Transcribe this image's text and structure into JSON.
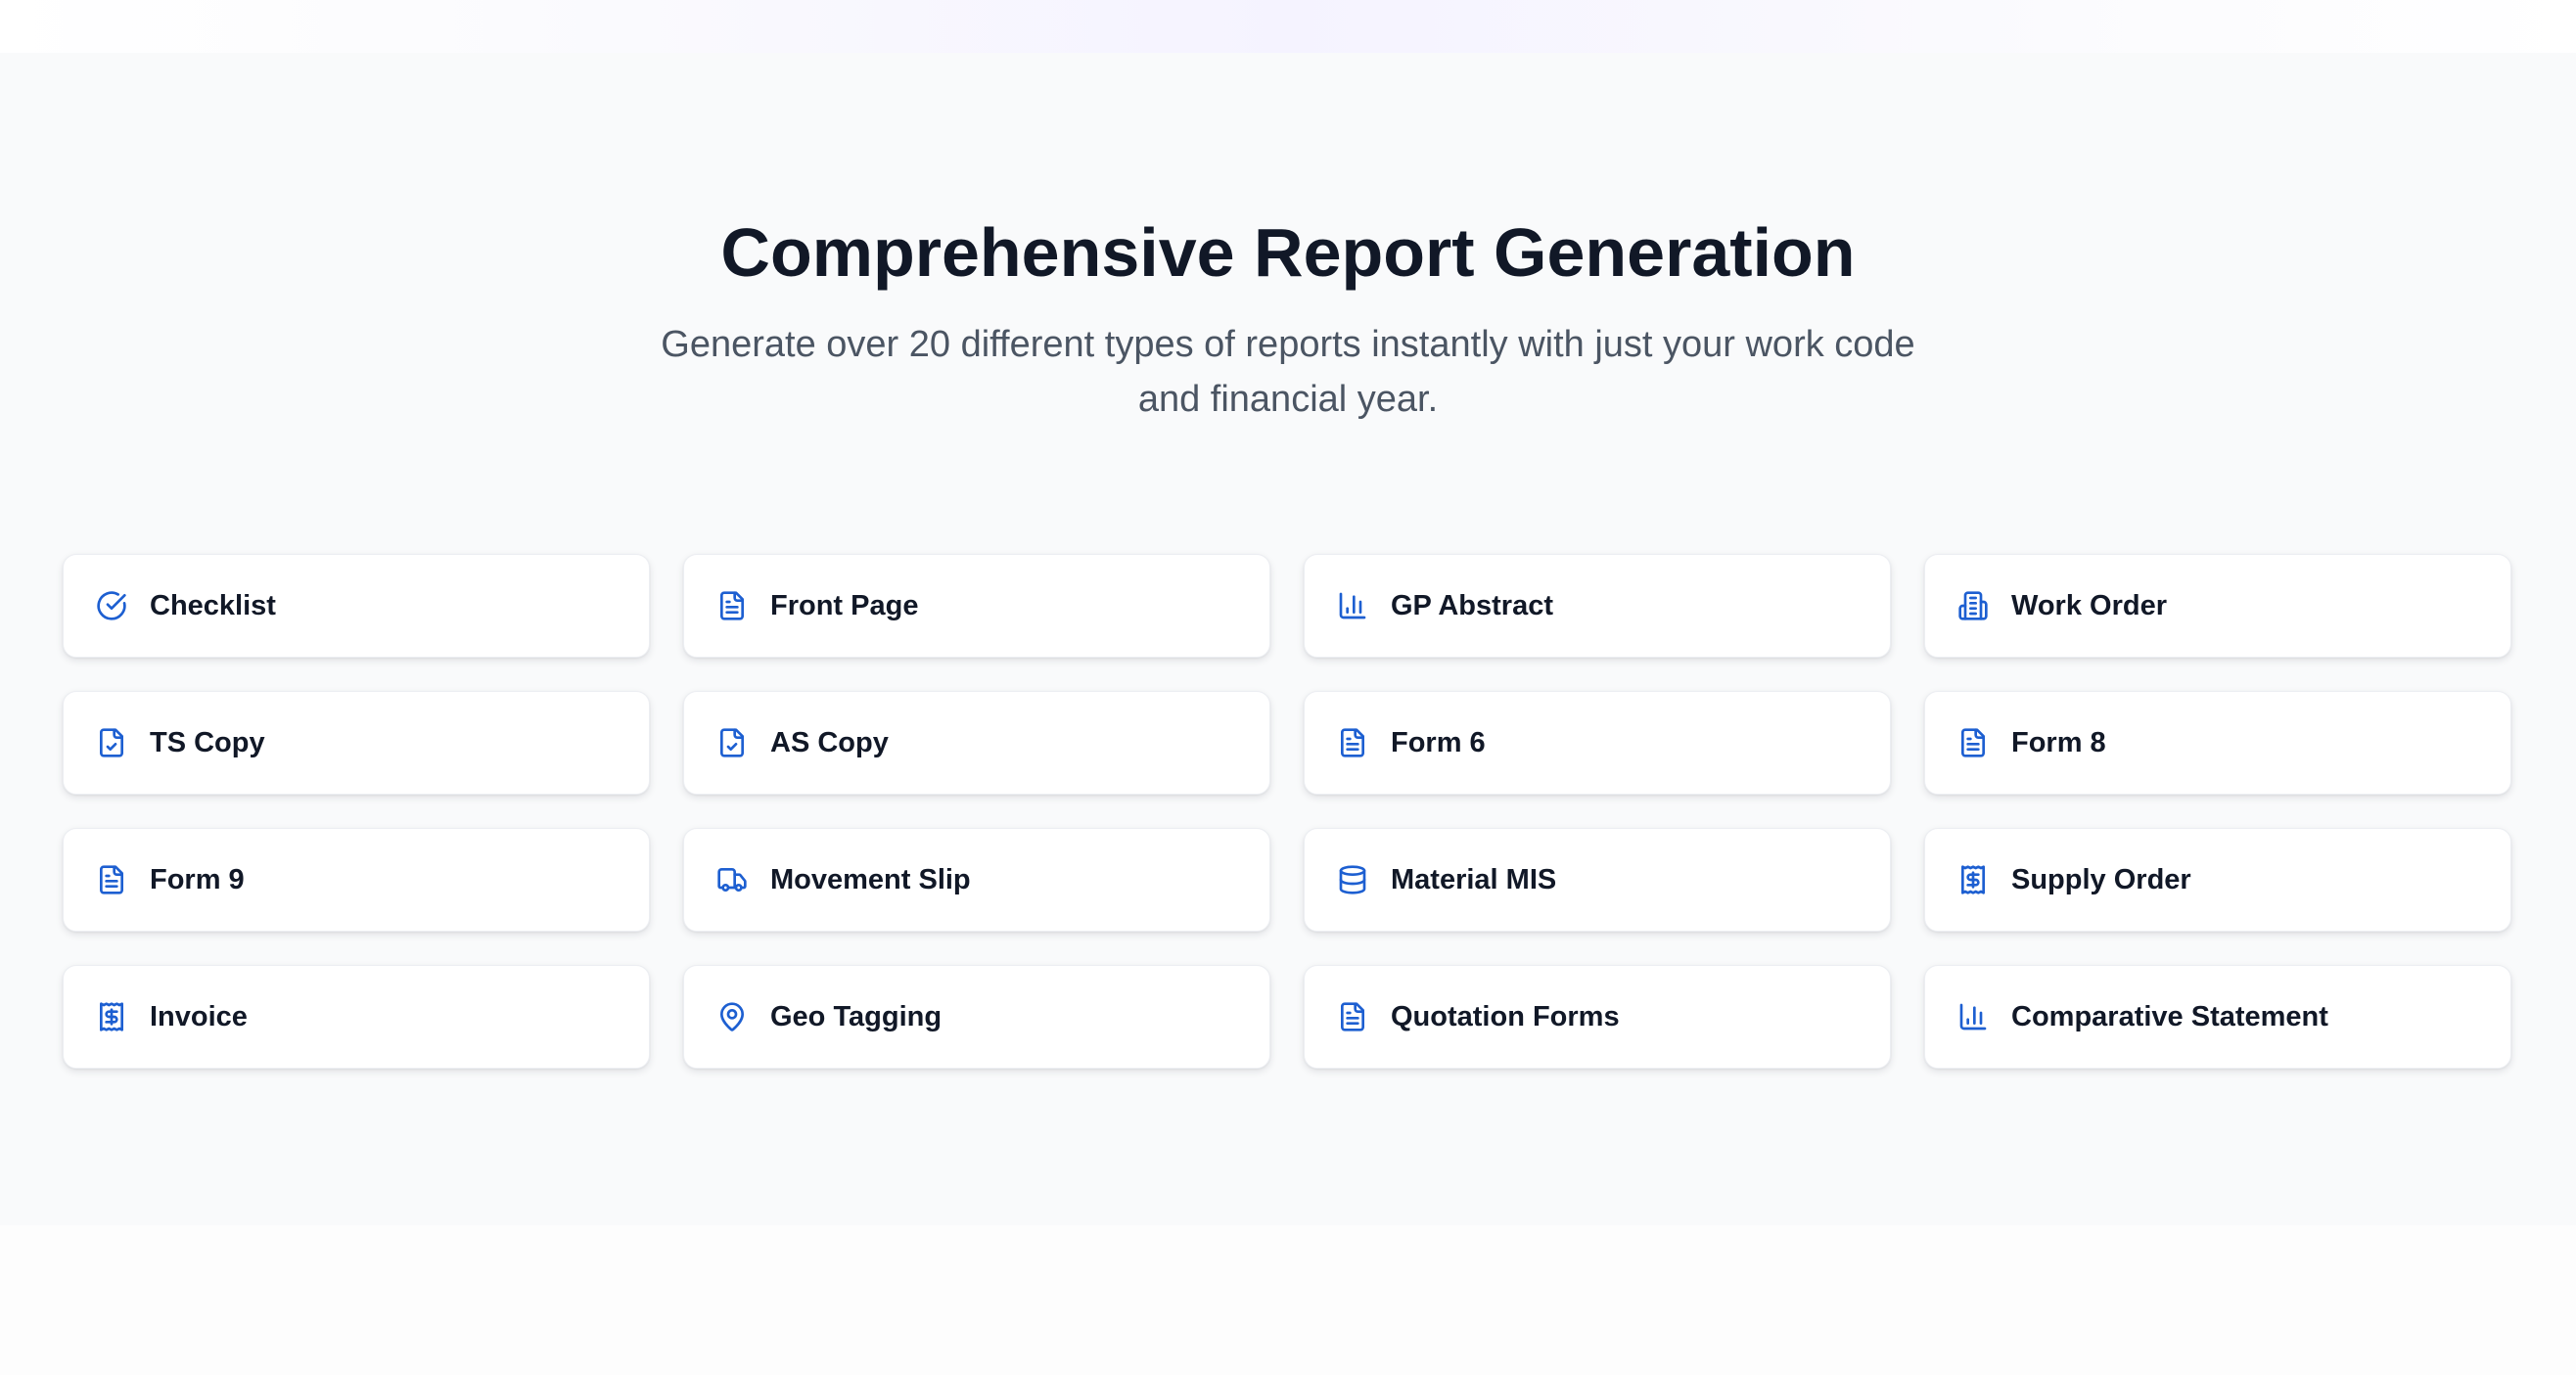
{
  "header": {
    "title": "Comprehensive Report Generation",
    "subtitle": "Generate over 20 different types of reports instantly with just your work code and financial year."
  },
  "colors": {
    "accent": "#1d5fd1",
    "title": "#111827",
    "subtitle": "#4b5563",
    "section_bg": "#f9fafb",
    "card_bg": "#ffffff"
  },
  "reports": [
    {
      "label": "Checklist",
      "icon": "check-circle-icon"
    },
    {
      "label": "Front Page",
      "icon": "file-text-icon"
    },
    {
      "label": "GP Abstract",
      "icon": "bar-chart-icon"
    },
    {
      "label": "Work Order",
      "icon": "building-icon"
    },
    {
      "label": "TS Copy",
      "icon": "file-check-icon"
    },
    {
      "label": "AS Copy",
      "icon": "file-check-icon"
    },
    {
      "label": "Form 6",
      "icon": "file-text-icon"
    },
    {
      "label": "Form 8",
      "icon": "file-text-icon"
    },
    {
      "label": "Form 9",
      "icon": "file-text-icon"
    },
    {
      "label": "Movement Slip",
      "icon": "truck-icon"
    },
    {
      "label": "Material MIS",
      "icon": "database-icon"
    },
    {
      "label": "Supply Order",
      "icon": "receipt-dollar-icon"
    },
    {
      "label": "Invoice",
      "icon": "receipt-dollar-icon"
    },
    {
      "label": "Geo Tagging",
      "icon": "map-pin-icon"
    },
    {
      "label": "Quotation Forms",
      "icon": "file-text-icon"
    },
    {
      "label": "Comparative Statement",
      "icon": "bar-chart-icon"
    }
  ]
}
